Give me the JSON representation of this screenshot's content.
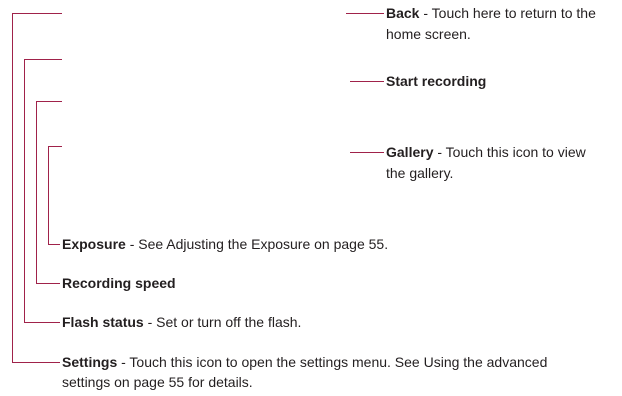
{
  "colors": {
    "leader": "#a0224a",
    "text": "#231f20"
  },
  "callouts": {
    "back": {
      "label": "Back",
      "desc": " - Touch here to return to the",
      "desc2": "home screen."
    },
    "start_recording": {
      "label": "Start recording"
    },
    "gallery": {
      "label": "Gallery",
      "desc": " - Touch this icon to view",
      "desc2": "the gallery."
    },
    "exposure": {
      "label": "Exposure",
      "desc": " - See Adjusting the Exposure on page 55."
    },
    "recording_speed": {
      "label": "Recording speed"
    },
    "flash_status": {
      "label": "Flash status",
      "desc": " - Set or turn off the flash."
    },
    "settings": {
      "label": "Settings",
      "desc": " - Touch this icon to open the settings menu. See Using the advanced",
      "desc2": "settings on page 55 for details."
    }
  }
}
